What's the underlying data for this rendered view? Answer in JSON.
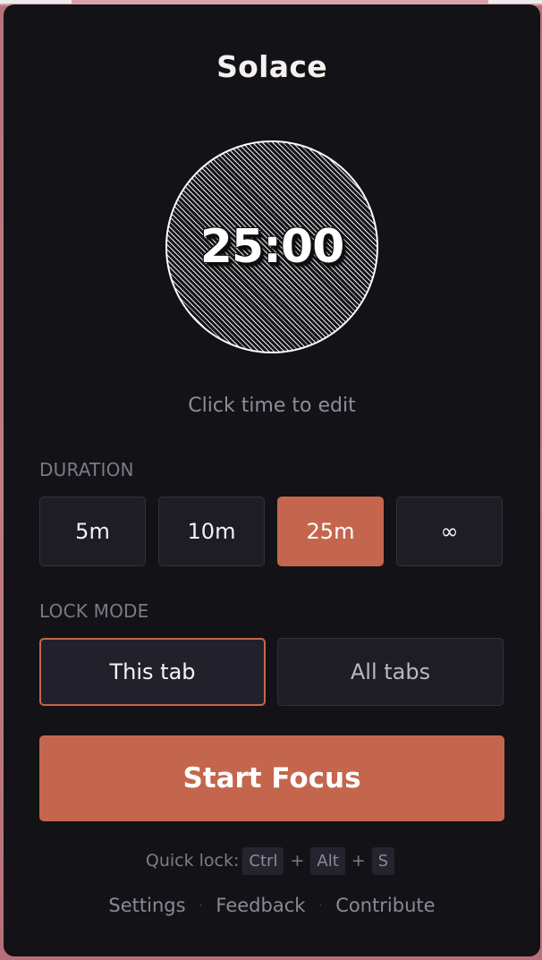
{
  "app": {
    "title": "Solace"
  },
  "timer": {
    "display": "25:00",
    "hint": "Click time to edit"
  },
  "duration": {
    "label": "DURATION",
    "options": [
      "5m",
      "10m",
      "25m",
      "∞"
    ],
    "selected": "25m"
  },
  "lock_mode": {
    "label": "LOCK MODE",
    "options": [
      "This tab",
      "All tabs"
    ],
    "selected": "This tab"
  },
  "start_button": {
    "label": "Start Focus"
  },
  "quick_lock": {
    "label": "Quick lock:",
    "keys": [
      "Ctrl",
      "Alt",
      "S"
    ],
    "separator": "+"
  },
  "footer": {
    "links": [
      "Settings",
      "Feedback",
      "Contribute"
    ],
    "separator": "·"
  },
  "colors": {
    "accent": "#c4664d",
    "background": "#131217",
    "button_bg": "#1e1d26"
  }
}
